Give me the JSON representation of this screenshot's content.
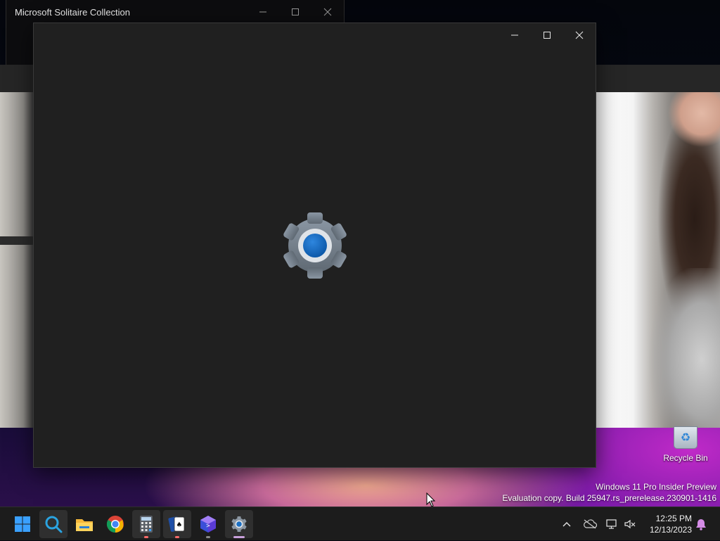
{
  "background_window": {
    "title": "Microsoft Solitaire Collection",
    "controls": [
      "minimize",
      "maximize",
      "close"
    ]
  },
  "main_window": {
    "controls": [
      "minimize",
      "maximize",
      "close"
    ],
    "content": "settings-gear-loading-icon"
  },
  "desktop": {
    "recycle_bin_label": "Recycle Bin",
    "watermark_line1": "Windows 11 Pro Insider Preview",
    "watermark_line2": "Evaluation copy. Build 25947.rs_prerelease.230901-1416"
  },
  "taskbar": {
    "apps": [
      {
        "name": "start",
        "icon": "windows-start-icon"
      },
      {
        "name": "search",
        "icon": "search-icon"
      },
      {
        "name": "file-explorer",
        "icon": "folder-icon"
      },
      {
        "name": "chrome",
        "icon": "chrome-icon"
      },
      {
        "name": "calculator",
        "icon": "calculator-icon"
      },
      {
        "name": "solitaire",
        "icon": "cards-icon"
      },
      {
        "name": "dev-home",
        "icon": "dev-home-icon"
      },
      {
        "name": "settings",
        "icon": "gear-icon"
      }
    ],
    "clock_time": "12:25 PM",
    "clock_date": "12/13/2023"
  },
  "colors": {
    "accent_blue": "#1a6fc4",
    "window_bg": "#202020",
    "taskbar_bg": "#1c1c1c"
  }
}
